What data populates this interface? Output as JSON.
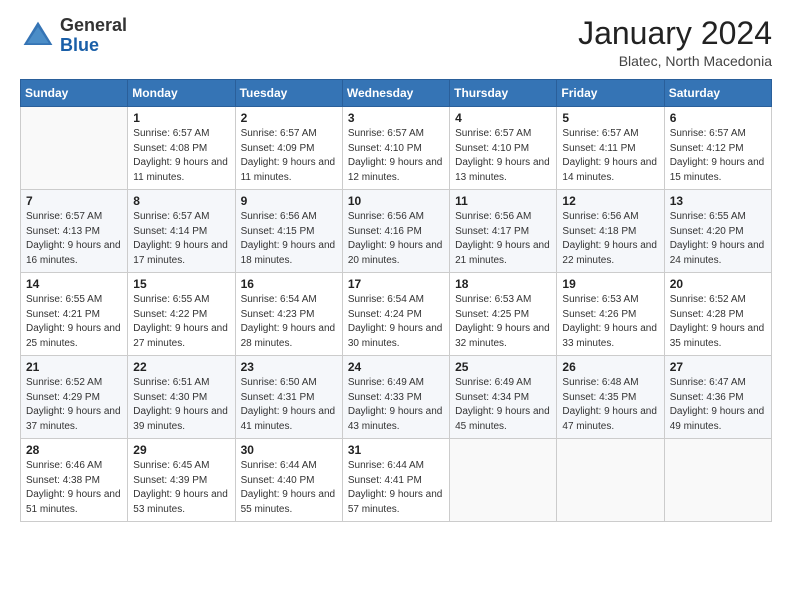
{
  "logo": {
    "general": "General",
    "blue": "Blue"
  },
  "header": {
    "month": "January 2024",
    "location": "Blatec, North Macedonia"
  },
  "days_of_week": [
    "Sunday",
    "Monday",
    "Tuesday",
    "Wednesday",
    "Thursday",
    "Friday",
    "Saturday"
  ],
  "weeks": [
    [
      {
        "day": "",
        "sunrise": "",
        "sunset": "",
        "daylight": ""
      },
      {
        "day": "1",
        "sunrise": "Sunrise: 6:57 AM",
        "sunset": "Sunset: 4:08 PM",
        "daylight": "Daylight: 9 hours and 11 minutes."
      },
      {
        "day": "2",
        "sunrise": "Sunrise: 6:57 AM",
        "sunset": "Sunset: 4:09 PM",
        "daylight": "Daylight: 9 hours and 11 minutes."
      },
      {
        "day": "3",
        "sunrise": "Sunrise: 6:57 AM",
        "sunset": "Sunset: 4:10 PM",
        "daylight": "Daylight: 9 hours and 12 minutes."
      },
      {
        "day": "4",
        "sunrise": "Sunrise: 6:57 AM",
        "sunset": "Sunset: 4:10 PM",
        "daylight": "Daylight: 9 hours and 13 minutes."
      },
      {
        "day": "5",
        "sunrise": "Sunrise: 6:57 AM",
        "sunset": "Sunset: 4:11 PM",
        "daylight": "Daylight: 9 hours and 14 minutes."
      },
      {
        "day": "6",
        "sunrise": "Sunrise: 6:57 AM",
        "sunset": "Sunset: 4:12 PM",
        "daylight": "Daylight: 9 hours and 15 minutes."
      }
    ],
    [
      {
        "day": "7",
        "sunrise": "Sunrise: 6:57 AM",
        "sunset": "Sunset: 4:13 PM",
        "daylight": "Daylight: 9 hours and 16 minutes."
      },
      {
        "day": "8",
        "sunrise": "Sunrise: 6:57 AM",
        "sunset": "Sunset: 4:14 PM",
        "daylight": "Daylight: 9 hours and 17 minutes."
      },
      {
        "day": "9",
        "sunrise": "Sunrise: 6:56 AM",
        "sunset": "Sunset: 4:15 PM",
        "daylight": "Daylight: 9 hours and 18 minutes."
      },
      {
        "day": "10",
        "sunrise": "Sunrise: 6:56 AM",
        "sunset": "Sunset: 4:16 PM",
        "daylight": "Daylight: 9 hours and 20 minutes."
      },
      {
        "day": "11",
        "sunrise": "Sunrise: 6:56 AM",
        "sunset": "Sunset: 4:17 PM",
        "daylight": "Daylight: 9 hours and 21 minutes."
      },
      {
        "day": "12",
        "sunrise": "Sunrise: 6:56 AM",
        "sunset": "Sunset: 4:18 PM",
        "daylight": "Daylight: 9 hours and 22 minutes."
      },
      {
        "day": "13",
        "sunrise": "Sunrise: 6:55 AM",
        "sunset": "Sunset: 4:20 PM",
        "daylight": "Daylight: 9 hours and 24 minutes."
      }
    ],
    [
      {
        "day": "14",
        "sunrise": "Sunrise: 6:55 AM",
        "sunset": "Sunset: 4:21 PM",
        "daylight": "Daylight: 9 hours and 25 minutes."
      },
      {
        "day": "15",
        "sunrise": "Sunrise: 6:55 AM",
        "sunset": "Sunset: 4:22 PM",
        "daylight": "Daylight: 9 hours and 27 minutes."
      },
      {
        "day": "16",
        "sunrise": "Sunrise: 6:54 AM",
        "sunset": "Sunset: 4:23 PM",
        "daylight": "Daylight: 9 hours and 28 minutes."
      },
      {
        "day": "17",
        "sunrise": "Sunrise: 6:54 AM",
        "sunset": "Sunset: 4:24 PM",
        "daylight": "Daylight: 9 hours and 30 minutes."
      },
      {
        "day": "18",
        "sunrise": "Sunrise: 6:53 AM",
        "sunset": "Sunset: 4:25 PM",
        "daylight": "Daylight: 9 hours and 32 minutes."
      },
      {
        "day": "19",
        "sunrise": "Sunrise: 6:53 AM",
        "sunset": "Sunset: 4:26 PM",
        "daylight": "Daylight: 9 hours and 33 minutes."
      },
      {
        "day": "20",
        "sunrise": "Sunrise: 6:52 AM",
        "sunset": "Sunset: 4:28 PM",
        "daylight": "Daylight: 9 hours and 35 minutes."
      }
    ],
    [
      {
        "day": "21",
        "sunrise": "Sunrise: 6:52 AM",
        "sunset": "Sunset: 4:29 PM",
        "daylight": "Daylight: 9 hours and 37 minutes."
      },
      {
        "day": "22",
        "sunrise": "Sunrise: 6:51 AM",
        "sunset": "Sunset: 4:30 PM",
        "daylight": "Daylight: 9 hours and 39 minutes."
      },
      {
        "day": "23",
        "sunrise": "Sunrise: 6:50 AM",
        "sunset": "Sunset: 4:31 PM",
        "daylight": "Daylight: 9 hours and 41 minutes."
      },
      {
        "day": "24",
        "sunrise": "Sunrise: 6:49 AM",
        "sunset": "Sunset: 4:33 PM",
        "daylight": "Daylight: 9 hours and 43 minutes."
      },
      {
        "day": "25",
        "sunrise": "Sunrise: 6:49 AM",
        "sunset": "Sunset: 4:34 PM",
        "daylight": "Daylight: 9 hours and 45 minutes."
      },
      {
        "day": "26",
        "sunrise": "Sunrise: 6:48 AM",
        "sunset": "Sunset: 4:35 PM",
        "daylight": "Daylight: 9 hours and 47 minutes."
      },
      {
        "day": "27",
        "sunrise": "Sunrise: 6:47 AM",
        "sunset": "Sunset: 4:36 PM",
        "daylight": "Daylight: 9 hours and 49 minutes."
      }
    ],
    [
      {
        "day": "28",
        "sunrise": "Sunrise: 6:46 AM",
        "sunset": "Sunset: 4:38 PM",
        "daylight": "Daylight: 9 hours and 51 minutes."
      },
      {
        "day": "29",
        "sunrise": "Sunrise: 6:45 AM",
        "sunset": "Sunset: 4:39 PM",
        "daylight": "Daylight: 9 hours and 53 minutes."
      },
      {
        "day": "30",
        "sunrise": "Sunrise: 6:44 AM",
        "sunset": "Sunset: 4:40 PM",
        "daylight": "Daylight: 9 hours and 55 minutes."
      },
      {
        "day": "31",
        "sunrise": "Sunrise: 6:44 AM",
        "sunset": "Sunset: 4:41 PM",
        "daylight": "Daylight: 9 hours and 57 minutes."
      },
      {
        "day": "",
        "sunrise": "",
        "sunset": "",
        "daylight": ""
      },
      {
        "day": "",
        "sunrise": "",
        "sunset": "",
        "daylight": ""
      },
      {
        "day": "",
        "sunrise": "",
        "sunset": "",
        "daylight": ""
      }
    ]
  ]
}
